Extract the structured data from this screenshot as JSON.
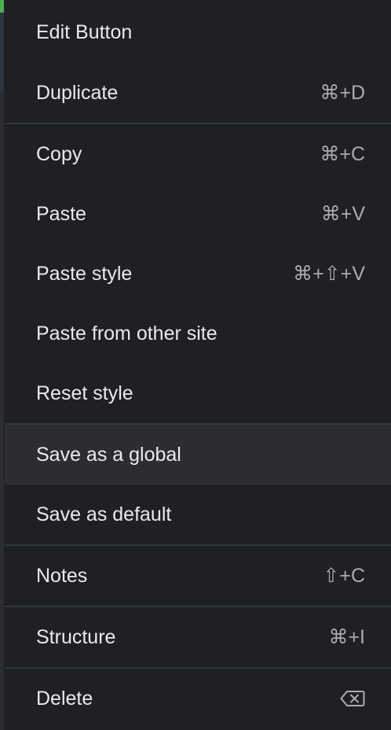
{
  "menu": {
    "edit": {
      "label": "Edit Button"
    },
    "duplicate": {
      "label": "Duplicate",
      "shortcut": "⌘+D"
    },
    "copy": {
      "label": "Copy",
      "shortcut": "⌘+C"
    },
    "paste": {
      "label": "Paste",
      "shortcut": "⌘+V"
    },
    "paste_style": {
      "label": "Paste style",
      "shortcut": "⌘+⇧+V"
    },
    "paste_other": {
      "label": "Paste from other site"
    },
    "reset_style": {
      "label": "Reset style"
    },
    "save_global": {
      "label": "Save as a global"
    },
    "save_default": {
      "label": "Save as default"
    },
    "notes": {
      "label": "Notes",
      "shortcut": "⇧+C"
    },
    "structure": {
      "label": "Structure",
      "shortcut": "⌘+I"
    },
    "delete": {
      "label": "Delete",
      "icon": "delete-key-icon"
    }
  },
  "colors": {
    "background": "#1e2023",
    "highlight": "#2b2d31",
    "divider": "#34373c",
    "text": "#e9eaec",
    "shortcut_text": "#a9abaf"
  }
}
